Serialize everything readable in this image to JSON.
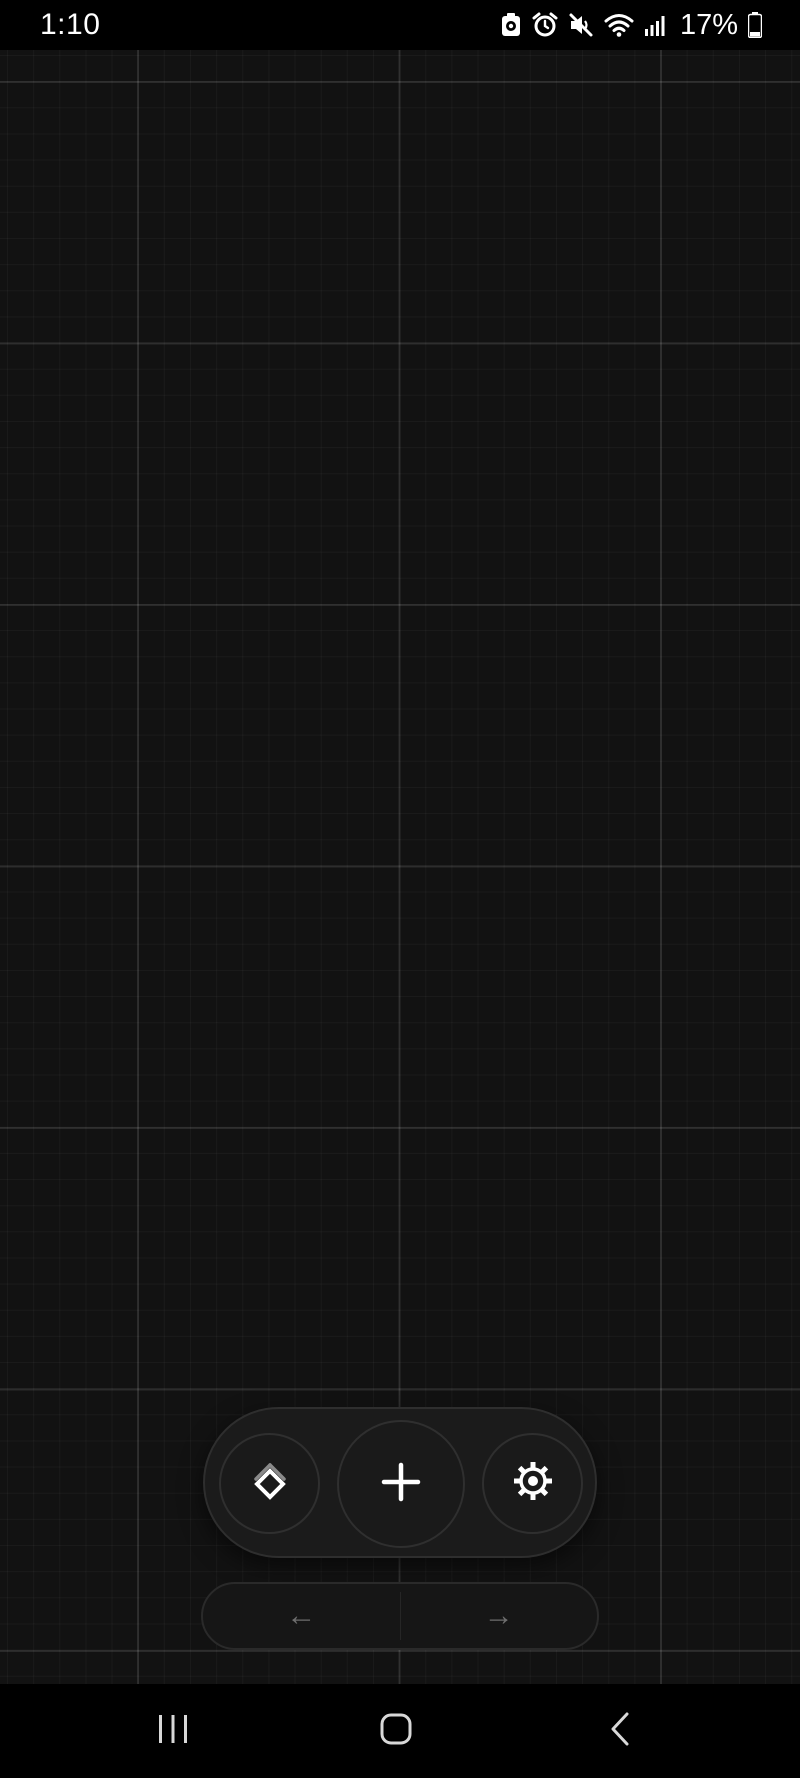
{
  "status_bar": {
    "time": "1:10",
    "battery_percent": "17%",
    "icons": [
      "screen-recorder-icon",
      "alarm-icon",
      "mute-icon",
      "wifi-icon",
      "signal-icon",
      "battery-icon"
    ]
  },
  "canvas": {
    "background": "#121212",
    "grid": true
  },
  "toolbar": {
    "left_icon": "layers-diamond-icon",
    "center_icon": "plus-icon",
    "right_icon": "gear-icon"
  },
  "history_nav": {
    "undo_label": "←",
    "redo_label": "→"
  },
  "system_nav": {
    "icons": [
      "recent-apps-icon",
      "home-icon",
      "back-icon"
    ]
  }
}
